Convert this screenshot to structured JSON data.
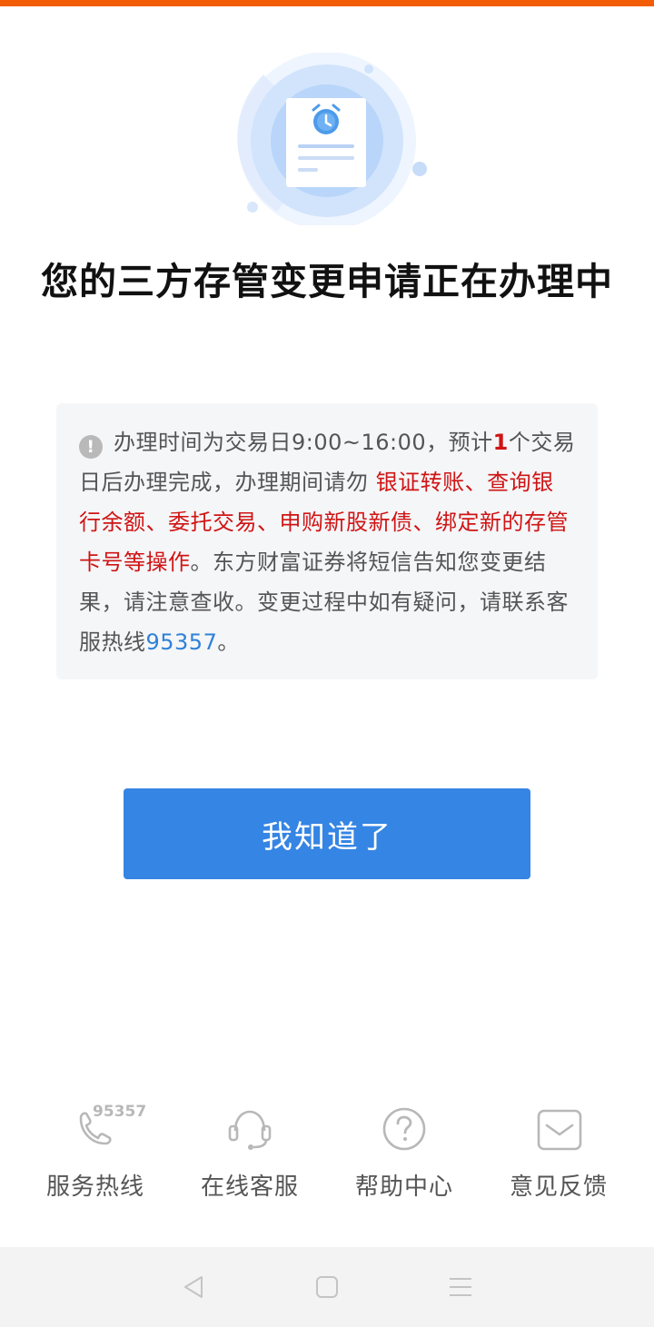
{
  "status": {
    "title": "您的三方存管变更申请正在办理中"
  },
  "notice": {
    "icon": "exclamation-circle-icon",
    "segments": [
      {
        "text": "办理时间为交易日9:00~16:00，预计",
        "style": "normal"
      },
      {
        "text": "1",
        "style": "red-bold"
      },
      {
        "text": "个交易日后办理完成，办理期间请勿 ",
        "style": "normal"
      },
      {
        "text": "银证转账、查询银行余额、委托交易、申购新股新债、绑定新的存管卡号等操作",
        "style": "red"
      },
      {
        "text": "。东方财富证券将短信告知您变更结果，请注意查收。变更过程中如有疑问，请联系客服热线",
        "style": "normal"
      },
      {
        "text": "95357",
        "style": "blue"
      },
      {
        "text": "。",
        "style": "normal"
      }
    ]
  },
  "actions": {
    "confirm_label": "我知道了"
  },
  "services": {
    "hotline_number": "95357",
    "hotline_label": "服务热线",
    "online_label": "在线客服",
    "help_label": "帮助中心",
    "feedback_label": "意见反馈"
  },
  "colors": {
    "accent": "#f25c05",
    "primary_button": "#3585e4",
    "warning_text": "#d01414",
    "link_text": "#2f81d8"
  }
}
